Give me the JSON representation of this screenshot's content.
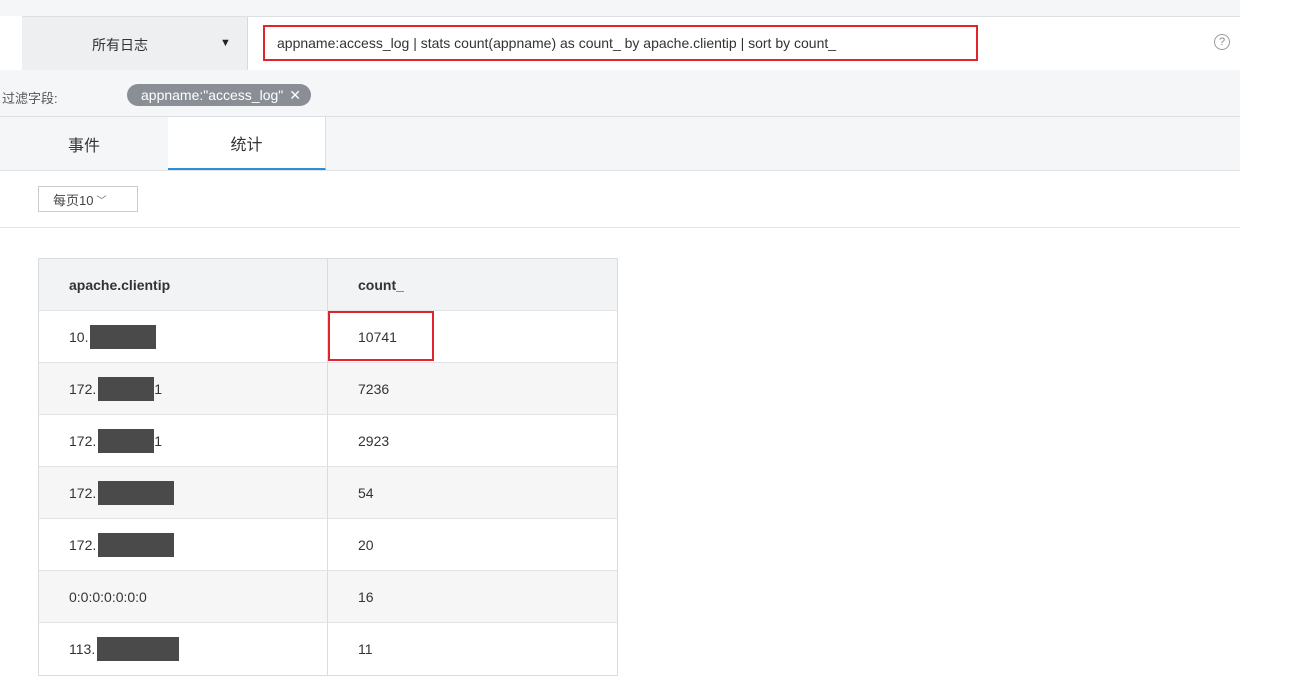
{
  "search": {
    "log_type_label": "所有日志",
    "query": "appname:access_log | stats count(appname) as count_ by apache.clientip | sort by count_",
    "help_icon": "question-circle-icon"
  },
  "filter": {
    "label": "过滤字段:",
    "chip_text": "appname:\"access_log\"",
    "chip_close": "✕"
  },
  "tabs": [
    {
      "label": "事件",
      "active": false
    },
    {
      "label": "统计",
      "active": true
    }
  ],
  "page_size": {
    "label": "每页10"
  },
  "table": {
    "columns": [
      "apache.clientip",
      "count_"
    ],
    "rows": [
      {
        "ip_prefix": "10.",
        "ip_suffix": "",
        "count": "10741",
        "highlighted": true
      },
      {
        "ip_prefix": "172.",
        "ip_suffix": "1",
        "count": "7236"
      },
      {
        "ip_prefix": "172.",
        "ip_suffix": "1",
        "count": "2923"
      },
      {
        "ip_prefix": "172.",
        "ip_suffix": "",
        "count": "54"
      },
      {
        "ip_prefix": "172.",
        "ip_suffix": "",
        "count": "20"
      },
      {
        "ip_prefix": "0:0:0:0:0:0:0",
        "ip_suffix": "",
        "count": "16"
      },
      {
        "ip_prefix": "113.",
        "ip_suffix": "",
        "count": "11"
      }
    ]
  },
  "colors": {
    "highlight": "#e0242a",
    "active_tab": "#2e8fd8",
    "chip_bg": "#8a8f96"
  }
}
